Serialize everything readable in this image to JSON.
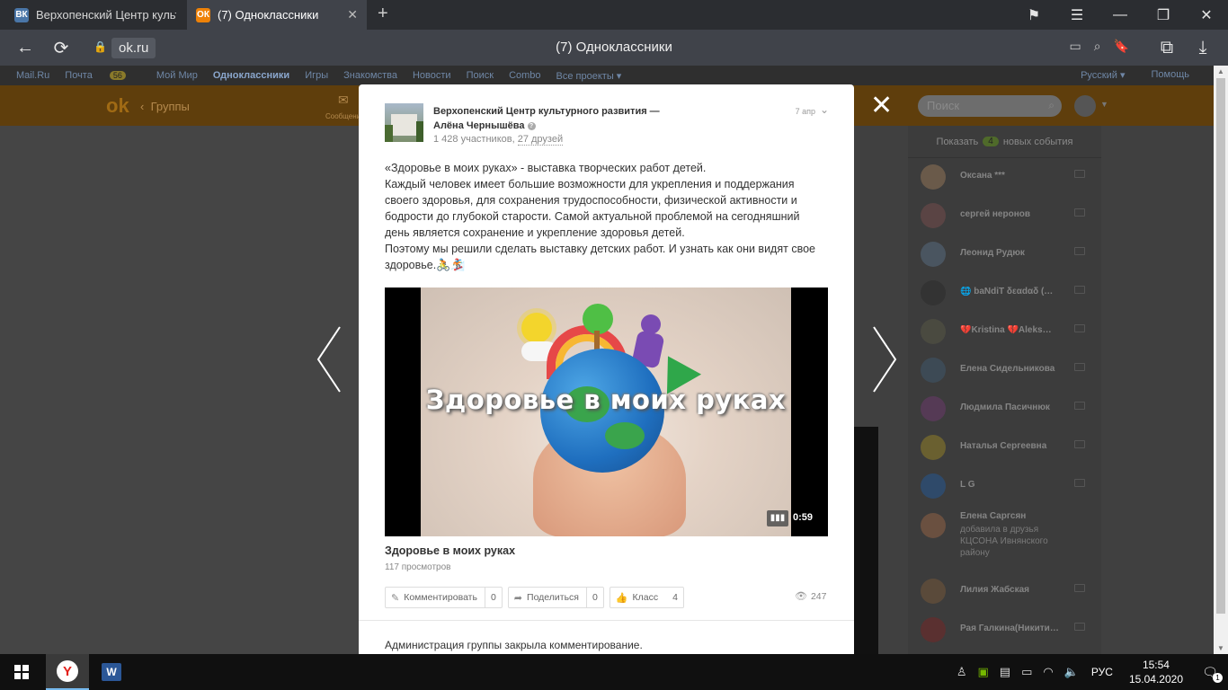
{
  "browser": {
    "tabs": [
      {
        "label": "Верхопенский Центр культ…",
        "favicon": "vk-icon",
        "favicon_text": "ВК"
      },
      {
        "label": "(7) Одноклассники",
        "favicon": "ok-icon",
        "favicon_text": "ОК"
      }
    ],
    "domain": "ok.ru",
    "page_title": "(7) Одноклассники"
  },
  "site_nav": {
    "items": [
      "Mail.Ru",
      "Почта",
      "Мой Мир",
      "Одноклассники",
      "Игры",
      "Знакомства",
      "Новости",
      "Поиск",
      "Combo",
      "Все проекты ▾"
    ],
    "mail_badge": "56",
    "lang": "Русский ▾",
    "help": "Помощь"
  },
  "ok_header": {
    "back_label": "Группы",
    "messages_label": "Сообщения",
    "search_placeholder": "Поиск"
  },
  "post": {
    "group_name": "Верхопенский Центр культурного развития —",
    "author": "Алёна Чернышёва",
    "members": "1 428 участников,",
    "friends_link": "27 друзей",
    "date": "7 апр",
    "text_lines": [
      "«Здоровье в моих руках» - выставка творческих работ детей.",
      "Каждый человек имеет большие возможности для укрепления и поддержания",
      "своего здоровья, для сохранения трудоспособности, физической активности и",
      "бодрости до глубокой старости. Самой актуальной проблемой на сегодняшний",
      "день является сохранение и укрепление здоровья детей.",
      "Поэтому мы решили сделать выставку детских работ. И узнать как они видят свое",
      "здоровье."
    ],
    "emoji": "🚴🏂",
    "video": {
      "overlay_title": "Здоровье в моих руках",
      "duration": "0:59",
      "title": "Здоровье в моих руках",
      "views": "117 просмотров"
    },
    "actions": {
      "comment_label": "Комментировать",
      "comment_count": "0",
      "share_label": "Поделиться",
      "share_count": "0",
      "like_label": "Класс",
      "like_count": "4"
    },
    "view_count": "247",
    "comments_closed": "Администрация группы закрыла комментирование."
  },
  "friends_panel": {
    "show_label": "Показать",
    "events_count": "4",
    "events_label": "новых события",
    "friends": [
      {
        "name": "Оксана ***",
        "color": "#6a5a4a"
      },
      {
        "name": "сергей неронов",
        "color": "#5a4444"
      },
      {
        "name": "Леонид Рудюк",
        "color": "#4a5560"
      },
      {
        "name": "🌐 baNdiT δεαdαδ (…",
        "color": "#333333"
      },
      {
        "name": "💔Kristina 💔Aleks…",
        "color": "#4a4a40"
      },
      {
        "name": "Елена Сидельникова",
        "color": "#3d4a55"
      },
      {
        "name": "Людмила Пасичнюк",
        "color": "#553a55"
      },
      {
        "name": "Наталья Сергеевна",
        "color": "#6a6030"
      },
      {
        "name": "L G",
        "color": "#2f4a6a"
      },
      {
        "name": "Елена Саргсян",
        "color": "#6a5040",
        "sub": "добавила в друзья КЦСОНА Ивнянского району"
      },
      {
        "name": "Лилия Жабская",
        "color": "#5a4a3a"
      },
      {
        "name": "Рая Галкина(Никити…",
        "color": "#5a3030"
      }
    ]
  },
  "taskbar": {
    "lang": "РУС",
    "time": "15:54",
    "date": "15.04.2020",
    "notifications": "1"
  }
}
